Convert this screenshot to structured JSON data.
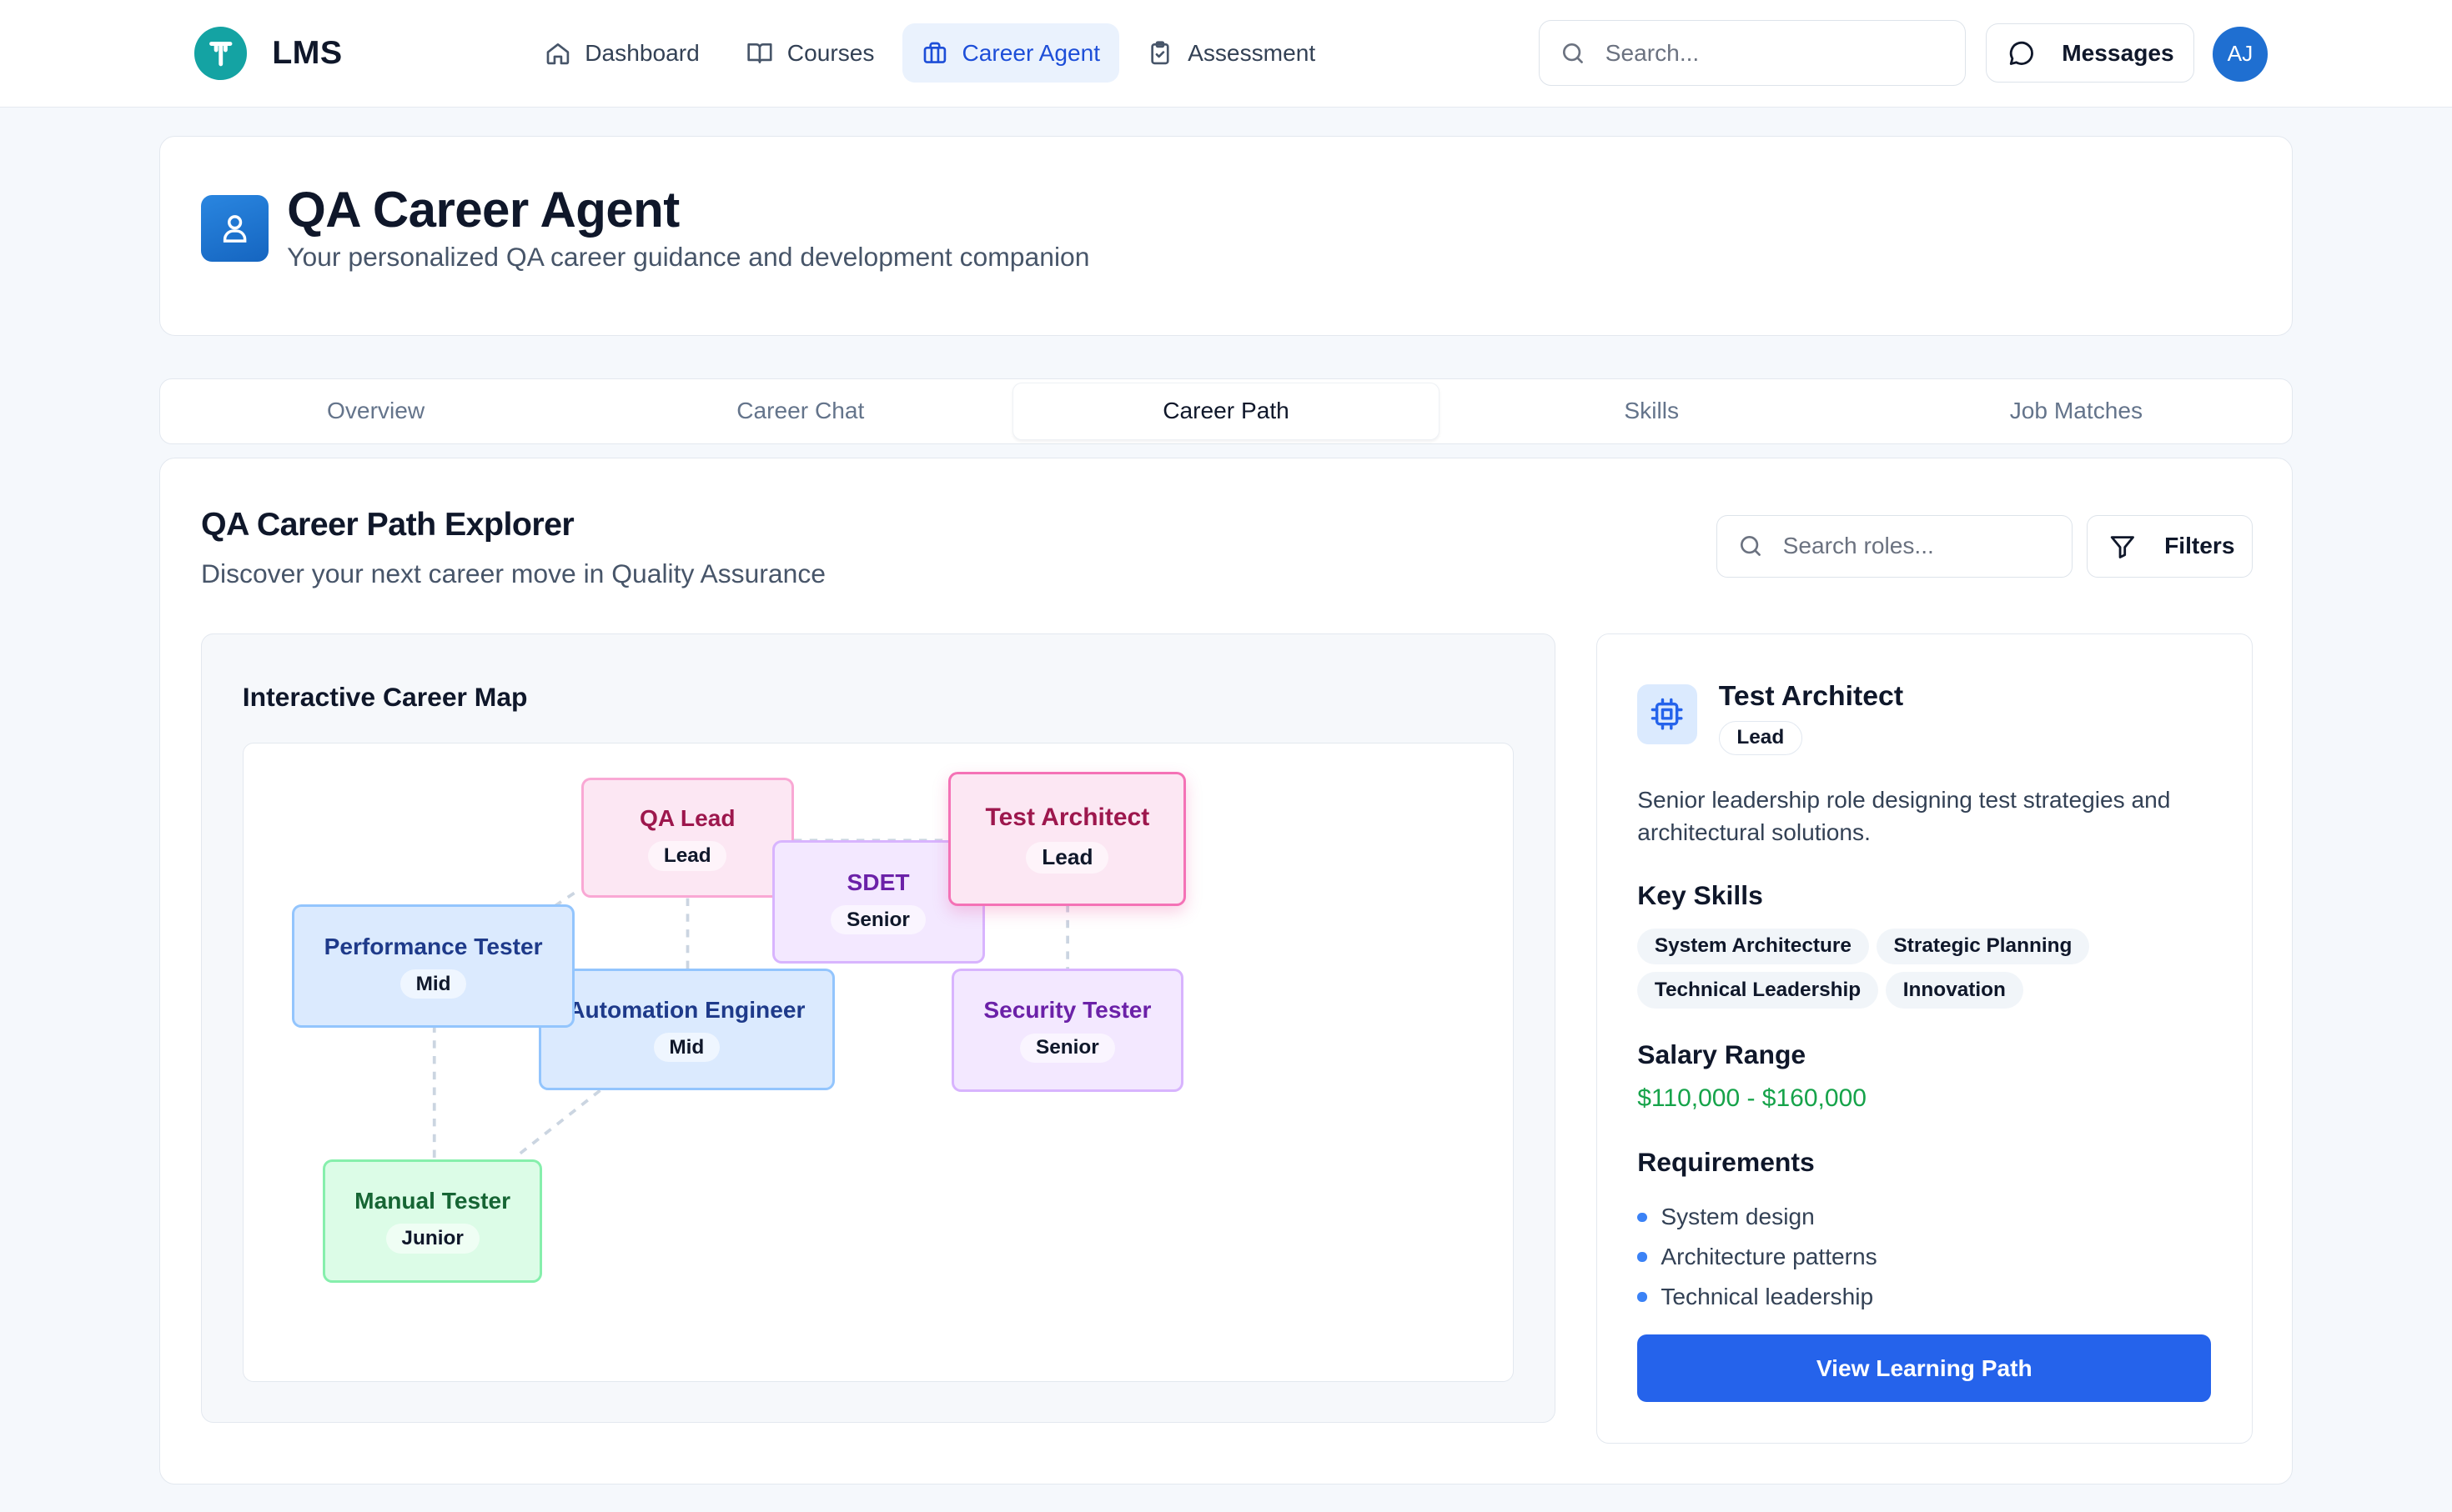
{
  "app": {
    "name": "LMS",
    "logo_letter": "T"
  },
  "nav": {
    "items": [
      {
        "label": "Dashboard",
        "icon": "home-icon"
      },
      {
        "label": "Courses",
        "icon": "book-icon"
      },
      {
        "label": "Career Agent",
        "icon": "briefcase-icon",
        "active": true
      },
      {
        "label": "Assessment",
        "icon": "clipboard-icon"
      }
    ],
    "search_placeholder": "Search...",
    "messages_label": "Messages",
    "user_initials": "AJ"
  },
  "header": {
    "title": "QA Career Agent",
    "subtitle": "Your personalized QA career guidance and development companion"
  },
  "tabs": [
    {
      "label": "Overview"
    },
    {
      "label": "Career Chat"
    },
    {
      "label": "Career Path",
      "active": true
    },
    {
      "label": "Skills"
    },
    {
      "label": "Job Matches"
    }
  ],
  "explorer": {
    "title": "QA Career Path Explorer",
    "subtitle": "Discover your next career move in Quality Assurance",
    "search_placeholder": "Search roles...",
    "filters_label": "Filters"
  },
  "career_map": {
    "title": "Interactive Career Map",
    "roles": [
      {
        "title": "Manual Tester",
        "level": "Junior"
      },
      {
        "title": "Performance Tester",
        "level": "Mid"
      },
      {
        "title": "Automation Engineer",
        "level": "Mid"
      },
      {
        "title": "SDET",
        "level": "Senior"
      },
      {
        "title": "QA Lead",
        "level": "Lead"
      },
      {
        "title": "Security Tester",
        "level": "Senior"
      },
      {
        "title": "Test Architect",
        "level": "Lead",
        "selected": true
      }
    ]
  },
  "detail": {
    "icon": "chip-icon",
    "title": "Test Architect",
    "level": "Lead",
    "description": "Senior leadership role designing test strategies and architectural solutions.",
    "skills_heading": "Key Skills",
    "skills": [
      "System Architecture",
      "Strategic Planning",
      "Technical Leadership",
      "Innovation"
    ],
    "salary_heading": "Salary Range",
    "salary": "$110,000 - $160,000",
    "requirements_heading": "Requirements",
    "requirements": [
      "System design",
      "Architecture patterns",
      "Technical leadership"
    ],
    "cta_label": "View Learning Path"
  },
  "colors": {
    "accent": "#2563eb",
    "brand": "#14a3a3",
    "salary": "#16a34a"
  }
}
